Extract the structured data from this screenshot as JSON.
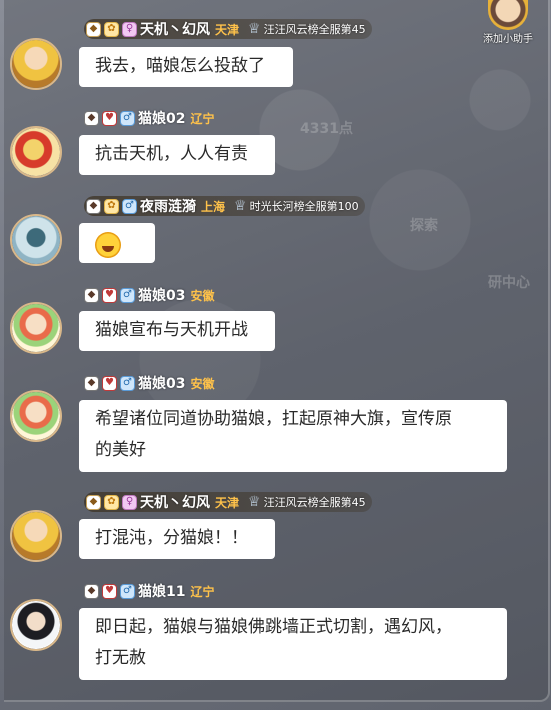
{
  "assistant": {
    "label": "添加小助手"
  },
  "map": {
    "labels": [
      "4331点",
      "研中心",
      "探索"
    ]
  },
  "messages": [
    {
      "badges": [
        "level",
        "gold",
        "female"
      ],
      "name": "天机丶幻风",
      "region": "天津",
      "rank": "汪汪风云榜全服第45",
      "text": "我去，喵娘怎么投敌了"
    },
    {
      "badges": [
        "level",
        "heart",
        "male"
      ],
      "name": "猫娘02",
      "region": "辽宁",
      "rank": "",
      "text": "抗击天机，人人有责"
    },
    {
      "badges": [
        "level",
        "gold",
        "male"
      ],
      "name": "夜雨涟漪",
      "region": "上海",
      "rank": "时光长河榜全服第100",
      "text": ""
    },
    {
      "badges": [
        "level",
        "heart",
        "male"
      ],
      "name": "猫娘03",
      "region": "安徽",
      "rank": "",
      "text": "猫娘宣布与天机开战"
    },
    {
      "badges": [
        "level",
        "heart",
        "male"
      ],
      "name": "猫娘03",
      "region": "安徽",
      "rank": "",
      "text_line1": "希望诸位同道协助猫娘，扛起原神大旗，宣传原",
      "text_line2": "的美好"
    },
    {
      "badges": [
        "level",
        "gold",
        "female"
      ],
      "name": "天机丶幻风",
      "region": "天津",
      "rank": "汪汪风云榜全服第45",
      "text": "打混沌，分猫娘！！"
    },
    {
      "badges": [
        "level",
        "heart",
        "male"
      ],
      "name": "猫娘11",
      "region": "辽宁",
      "rank": "",
      "text_line1": "即日起，猫娘与猫娘佛跳墙正式切割，遇幻风，",
      "text_line2": "打无赦"
    }
  ]
}
